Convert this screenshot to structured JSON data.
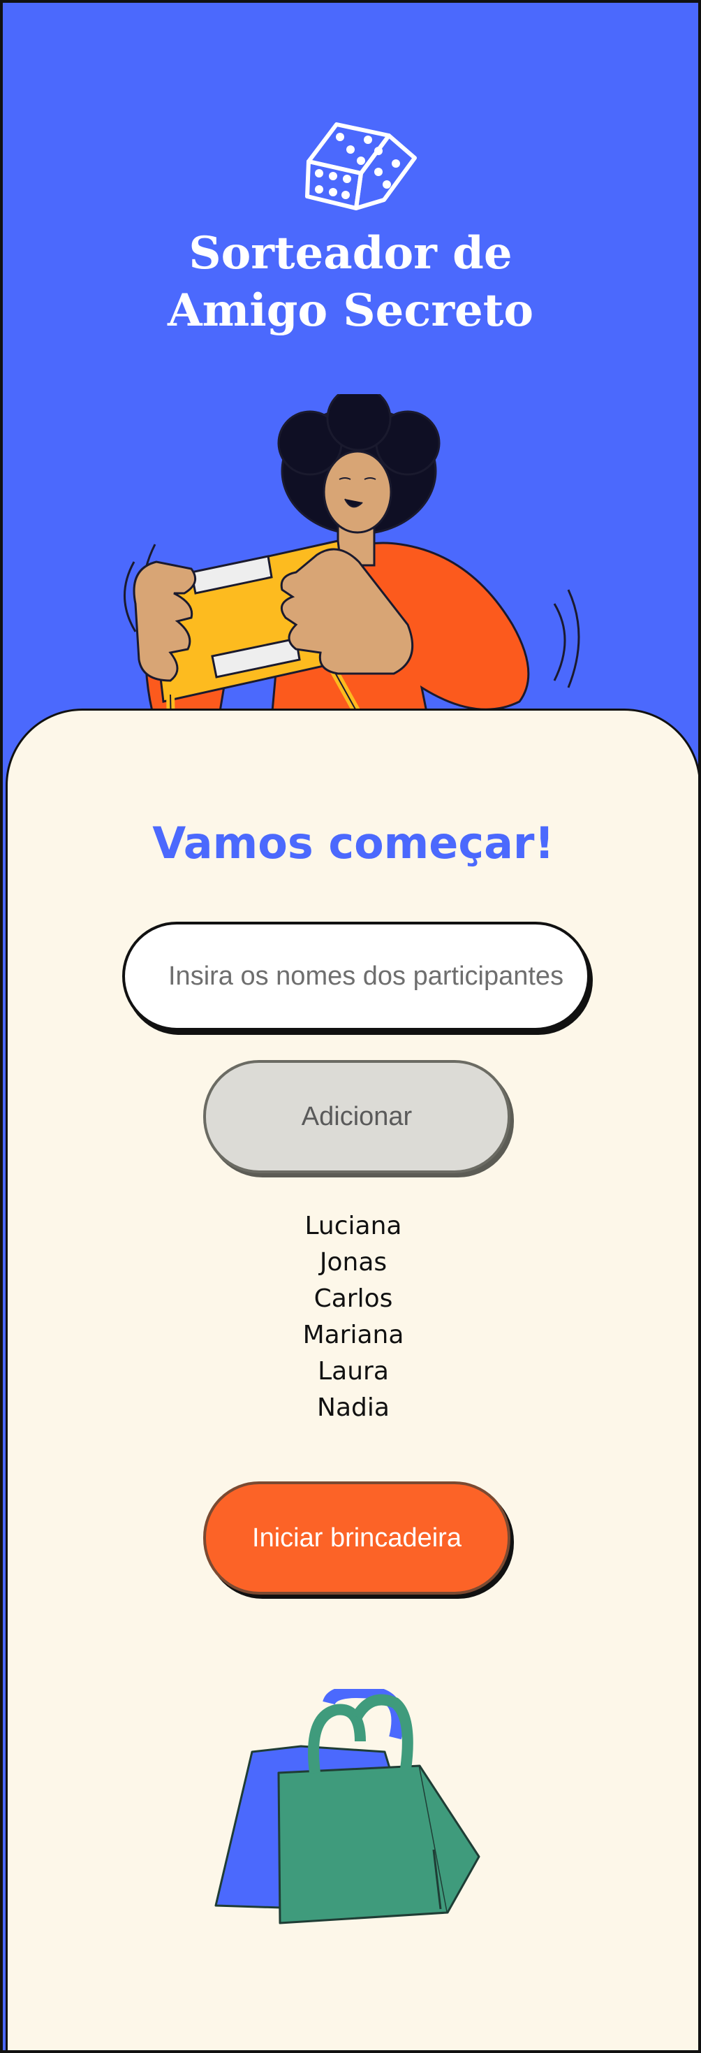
{
  "header": {
    "title_line1": "Sorteador de",
    "title_line2": "Amigo Secreto"
  },
  "main": {
    "heading": "Vamos começar!",
    "input_placeholder": "Insira os nomes dos participantes",
    "input_value": "",
    "add_button_label": "Adicionar",
    "participants": [
      "Luciana",
      "Jonas",
      "Carlos",
      "Mariana",
      "Laura",
      "Nadia"
    ],
    "start_button_label": "Iniciar brincadeira"
  },
  "icons": {
    "dice": "dice-icon",
    "person": "person-with-gift-illustration",
    "bags": "shopping-bags-illustration"
  },
  "colors": {
    "header_bg": "#4b69fd",
    "card_bg": "#fdf7e9",
    "heading": "#4b69fd",
    "start_button": "#fc6327",
    "add_button": "#dcdbd6",
    "bag_green": "#3f9b7c",
    "bag_blue": "#4b69fd"
  }
}
